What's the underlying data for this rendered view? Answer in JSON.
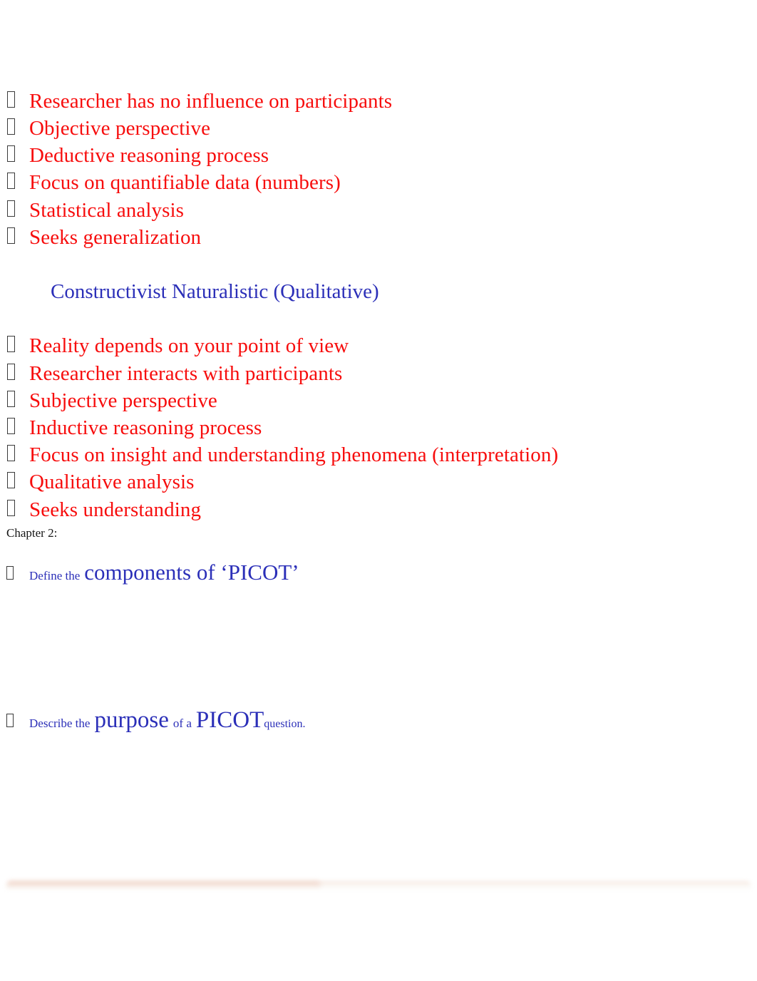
{
  "document": {
    "background_color": "#ffffff",
    "bullet_glyph": "missing-glyph-box"
  },
  "colors": {
    "bullet_red": "#f70d0d",
    "heading_blue": "#2b2fb8",
    "chapter_black": "#161616"
  },
  "quantitative_list": {
    "items": [
      {
        "text": "Researcher has no influence on participants"
      },
      {
        "text": "Objective perspective"
      },
      {
        "text": "Deductive reasoning process"
      },
      {
        "text": "Focus on quantifiable data (numbers)"
      },
      {
        "text": "Statistical analysis"
      },
      {
        "text": "Seeks generalization"
      }
    ]
  },
  "section_heading": {
    "text": "Constructivist Naturalistic (Qualitative)"
  },
  "qualitative_list": {
    "items": [
      {
        "text": "Reality depends on your point of view"
      },
      {
        "text": "Researcher interacts with participants"
      },
      {
        "text": "Subjective perspective"
      },
      {
        "text": "Inductive reasoning process"
      },
      {
        "text": "Focus on insight and understanding phenomena (interpretation)"
      },
      {
        "text": "Qualitative analysis"
      },
      {
        "text": "Seeks understanding"
      }
    ]
  },
  "chapter": {
    "label": "Chapter 2:"
  },
  "picot_objectives": [
    {
      "id": "define-components",
      "parts": [
        {
          "text": "Define the",
          "size": "small"
        },
        {
          "text": "components of ‘PICOT’",
          "size": "large"
        }
      ]
    },
    {
      "id": "describe-purpose",
      "parts": [
        {
          "text": "Describe the",
          "size": "small"
        },
        {
          "text": "purpose",
          "size": "large"
        },
        {
          "text": "of a",
          "size": "small"
        },
        {
          "text": "PICOT",
          "size": "large"
        },
        {
          "text": "question.",
          "size": "small"
        }
      ]
    }
  ]
}
